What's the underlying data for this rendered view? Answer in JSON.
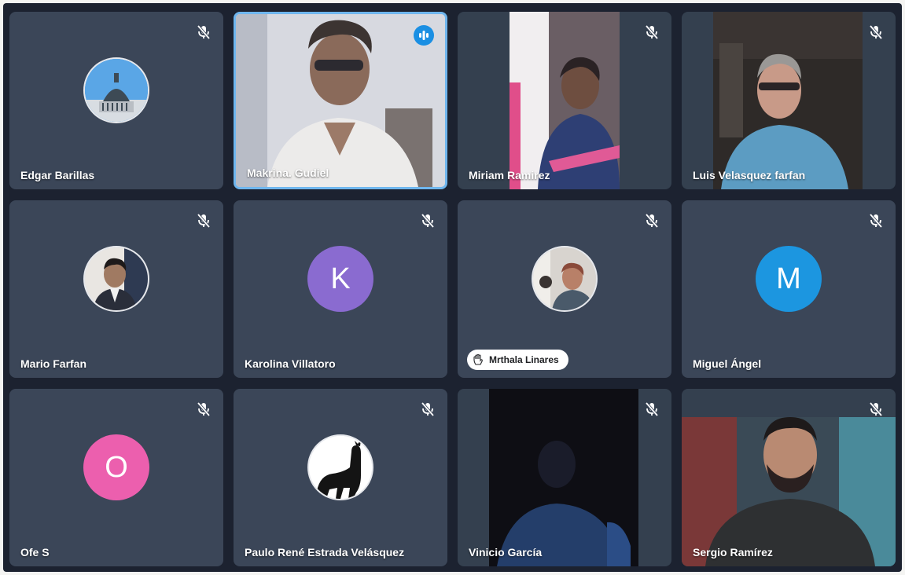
{
  "meeting": {
    "participants": [
      {
        "name": "Edgar Barillas",
        "muted": true,
        "display": "photo",
        "icon": "church-dome-photo"
      },
      {
        "name": "Makrina. Gudiel",
        "muted": false,
        "speaking": true,
        "display": "video"
      },
      {
        "name": "Miriam Ramirez",
        "muted": true,
        "display": "video"
      },
      {
        "name": "Luis Velasquez farfan",
        "muted": true,
        "display": "video"
      },
      {
        "name": "Mario Farfan",
        "muted": true,
        "display": "photo"
      },
      {
        "name": "Karolina Villatoro",
        "muted": true,
        "display": "initial",
        "initial": "K",
        "color": "#8a6bd0"
      },
      {
        "name": "Mrthala Linares",
        "muted": true,
        "display": "photo",
        "badge": "raised-hand-icon"
      },
      {
        "name": "Miguel Ángel",
        "muted": true,
        "display": "initial",
        "initial": "M",
        "color": "#1c96e0"
      },
      {
        "name": "Ofe S",
        "muted": true,
        "display": "initial",
        "initial": "O",
        "color": "#ec5fae"
      },
      {
        "name": "Paulo René Estrada Velásquez",
        "muted": true,
        "display": "photo",
        "icon": "black-cat-photo"
      },
      {
        "name": "Vinicio García",
        "muted": true,
        "display": "video"
      },
      {
        "name": "Sergio Ramírez",
        "muted": true,
        "display": "video"
      }
    ]
  }
}
